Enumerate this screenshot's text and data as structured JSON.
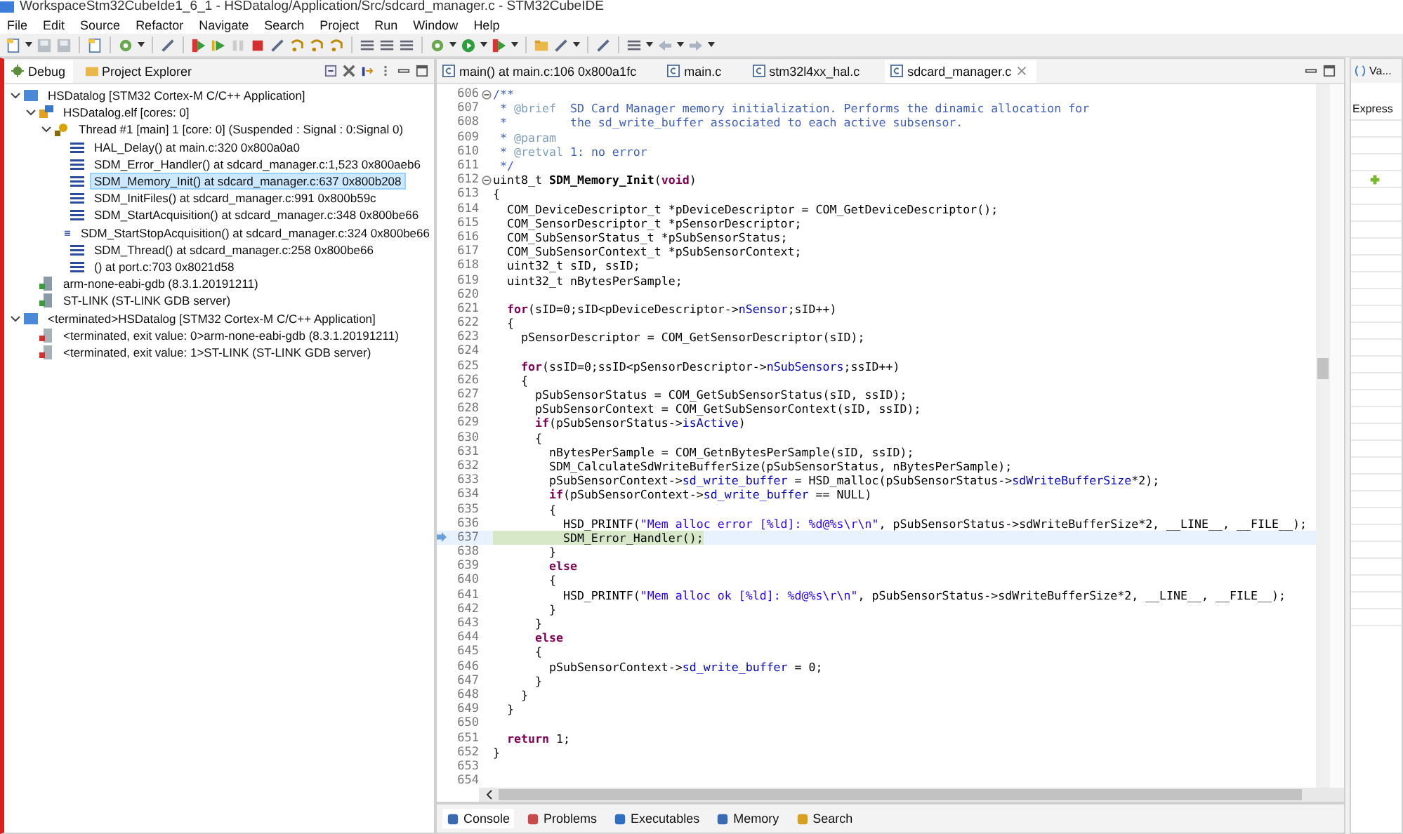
{
  "window": {
    "title": "WorkspaceStm32CubeIde1_6_1 - HSDatalog/Application/Src/sdcard_manager.c - STM32CubeIDE"
  },
  "menu": [
    "File",
    "Edit",
    "Source",
    "Refactor",
    "Navigate",
    "Search",
    "Project",
    "Run",
    "Window",
    "Help"
  ],
  "left_panel": {
    "tabs": [
      {
        "label": "Debug",
        "selected": true
      },
      {
        "label": "Project Explorer",
        "selected": false
      }
    ],
    "tree": [
      {
        "kind": "launch",
        "label": "HSDatalog [STM32 Cortex-M C/C++ Application]",
        "expanded": true,
        "selected": false,
        "children": [
          {
            "kind": "elf",
            "label": "HSDatalog.elf [cores: 0]",
            "expanded": true,
            "selected": false,
            "children": [
              {
                "kind": "thread",
                "label": "Thread #1 [main] 1 [core: 0] (Suspended : Signal : 0:Signal 0)",
                "expanded": true,
                "selected": false,
                "children": [
                  {
                    "kind": "frame",
                    "label": "HAL_Delay() at main.c:320 0x800a0a0",
                    "selected": false
                  },
                  {
                    "kind": "frame",
                    "label": "SDM_Error_Handler() at sdcard_manager.c:1,523 0x800aeb6",
                    "selected": false
                  },
                  {
                    "kind": "frame",
                    "label": "SDM_Memory_Init() at sdcard_manager.c:637 0x800b208",
                    "selected": true
                  },
                  {
                    "kind": "frame",
                    "label": "SDM_InitFiles() at sdcard_manager.c:991 0x800b59c",
                    "selected": false
                  },
                  {
                    "kind": "frame",
                    "label": "SDM_StartAcquisition() at sdcard_manager.c:348 0x800be66",
                    "selected": false
                  },
                  {
                    "kind": "frame",
                    "label": "SDM_StartStopAcquisition() at sdcard_manager.c:324 0x800be66",
                    "selected": false
                  },
                  {
                    "kind": "frame",
                    "label": "SDM_Thread() at sdcard_manager.c:258 0x800be66",
                    "selected": false
                  },
                  {
                    "kind": "frame",
                    "label": "() at port.c:703 0x8021d58",
                    "selected": false
                  }
                ]
              }
            ]
          },
          {
            "kind": "process",
            "label": "arm-none-eabi-gdb (8.3.1.20191211)",
            "selected": false
          },
          {
            "kind": "process",
            "label": "ST-LINK (ST-LINK GDB server)",
            "selected": false
          }
        ]
      },
      {
        "kind": "launch",
        "label": "<terminated>HSDatalog [STM32 Cortex-M C/C++ Application]",
        "expanded": true,
        "selected": false,
        "children": [
          {
            "kind": "terminated",
            "label": "<terminated, exit value: 0>arm-none-eabi-gdb (8.3.1.20191211)",
            "selected": false
          },
          {
            "kind": "terminated",
            "label": "<terminated, exit value: 1>ST-LINK (ST-LINK GDB server)",
            "selected": false
          }
        ]
      }
    ]
  },
  "editor": {
    "tabs": [
      {
        "label": "main() at main.c:106 0x800a1fc",
        "selected": false,
        "closable": false
      },
      {
        "label": "main.c",
        "selected": false,
        "closable": false
      },
      {
        "label": "stm32l4xx_hal.c",
        "selected": false,
        "closable": false
      },
      {
        "label": "sdcard_manager.c",
        "selected": true,
        "closable": true
      }
    ],
    "lines": [
      {
        "n": "606",
        "fold": true,
        "current": false,
        "s": [
          {
            "kind": "comment",
            "t": "/**"
          }
        ]
      },
      {
        "n": "607",
        "fold": false,
        "current": false,
        "s": [
          {
            "kind": "comment",
            "t": " * "
          },
          {
            "kind": "tag",
            "t": "@brief"
          },
          {
            "kind": "comment",
            "t": "  SD Card Manager memory initialization. Performs the dinamic allocation for"
          }
        ]
      },
      {
        "n": "608",
        "fold": false,
        "current": false,
        "s": [
          {
            "kind": "comment",
            "t": " *         the sd_write_buffer associated to each active subsensor."
          }
        ]
      },
      {
        "n": "609",
        "fold": false,
        "current": false,
        "s": [
          {
            "kind": "comment",
            "t": " * "
          },
          {
            "kind": "tag",
            "t": "@param"
          }
        ]
      },
      {
        "n": "610",
        "fold": false,
        "current": false,
        "s": [
          {
            "kind": "comment",
            "t": " * "
          },
          {
            "kind": "tag",
            "t": "@retval"
          },
          {
            "kind": "comment",
            "t": " 1: no error"
          }
        ]
      },
      {
        "n": "611",
        "fold": false,
        "current": false,
        "s": [
          {
            "kind": "comment",
            "t": " */"
          }
        ]
      },
      {
        "n": "612",
        "fold": true,
        "current": false,
        "s": [
          {
            "kind": "text",
            "t": "uint8_t "
          },
          {
            "kind": "fn",
            "t": "SDM_Memory_Init"
          },
          {
            "kind": "text",
            "t": "("
          },
          {
            "kind": "kw",
            "t": "void"
          },
          {
            "kind": "text",
            "t": ")"
          }
        ]
      },
      {
        "n": "613",
        "fold": false,
        "current": false,
        "s": [
          {
            "kind": "text",
            "t": "{"
          }
        ]
      },
      {
        "n": "614",
        "fold": false,
        "current": false,
        "s": [
          {
            "kind": "text",
            "t": "  COM_DeviceDescriptor_t *pDeviceDescriptor = COM_GetDeviceDescriptor();"
          }
        ]
      },
      {
        "n": "615",
        "fold": false,
        "current": false,
        "s": [
          {
            "kind": "text",
            "t": "  COM_SensorDescriptor_t *pSensorDescriptor;"
          }
        ]
      },
      {
        "n": "616",
        "fold": false,
        "current": false,
        "s": [
          {
            "kind": "text",
            "t": "  COM_SubSensorStatus_t *pSubSensorStatus;"
          }
        ]
      },
      {
        "n": "617",
        "fold": false,
        "current": false,
        "s": [
          {
            "kind": "text",
            "t": "  COM_SubSensorContext_t *pSubSensorContext;"
          }
        ]
      },
      {
        "n": "618",
        "fold": false,
        "current": false,
        "s": [
          {
            "kind": "text",
            "t": "  uint32_t sID, ssID;"
          }
        ]
      },
      {
        "n": "619",
        "fold": false,
        "current": false,
        "s": [
          {
            "kind": "text",
            "t": "  uint32_t nBytesPerSample;"
          }
        ]
      },
      {
        "n": "620",
        "fold": false,
        "current": false
      },
      {
        "n": "621",
        "fold": false,
        "current": false,
        "s": [
          {
            "kind": "kw",
            "t": "  for"
          },
          {
            "kind": "text",
            "t": "(sID=0;sID<pDeviceDescriptor->"
          },
          {
            "kind": "field",
            "t": "nSensor"
          },
          {
            "kind": "text",
            "t": ";sID++)"
          }
        ]
      },
      {
        "n": "622",
        "fold": false,
        "current": false,
        "s": [
          {
            "kind": "text",
            "t": "  {"
          }
        ]
      },
      {
        "n": "623",
        "fold": false,
        "current": false,
        "s": [
          {
            "kind": "text",
            "t": "    pSensorDescriptor = COM_GetSensorDescriptor(sID);"
          }
        ]
      },
      {
        "n": "624",
        "fold": false,
        "current": false
      },
      {
        "n": "625",
        "fold": false,
        "current": false,
        "s": [
          {
            "kind": "kw",
            "t": "    for"
          },
          {
            "kind": "text",
            "t": "(ssID=0;ssID<pSensorDescriptor->"
          },
          {
            "kind": "field",
            "t": "nSubSensors"
          },
          {
            "kind": "text",
            "t": ";ssID++)"
          }
        ]
      },
      {
        "n": "626",
        "fold": false,
        "current": false,
        "s": [
          {
            "kind": "text",
            "t": "    {"
          }
        ]
      },
      {
        "n": "627",
        "fold": false,
        "current": false,
        "s": [
          {
            "kind": "text",
            "t": "      pSubSensorStatus = COM_GetSubSensorStatus(sID, ssID);"
          }
        ]
      },
      {
        "n": "628",
        "fold": false,
        "current": false,
        "s": [
          {
            "kind": "text",
            "t": "      pSubSensorContext = COM_GetSubSensorContext(sID, ssID);"
          }
        ]
      },
      {
        "n": "629",
        "fold": false,
        "current": false,
        "s": [
          {
            "kind": "kw",
            "t": "      if"
          },
          {
            "kind": "text",
            "t": "(pSubSensorStatus->"
          },
          {
            "kind": "field",
            "t": "isActive"
          },
          {
            "kind": "text",
            "t": ")"
          }
        ]
      },
      {
        "n": "630",
        "fold": false,
        "current": false,
        "s": [
          {
            "kind": "text",
            "t": "      {"
          }
        ]
      },
      {
        "n": "631",
        "fold": false,
        "current": false,
        "s": [
          {
            "kind": "text",
            "t": "        nBytesPerSample = COM_GetnBytesPerSample(sID, ssID);"
          }
        ]
      },
      {
        "n": "632",
        "fold": false,
        "current": false,
        "s": [
          {
            "kind": "text",
            "t": "        SDM_CalculateSdWriteBufferSize(pSubSensorStatus, nBytesPerSample);"
          }
        ]
      },
      {
        "n": "633",
        "fold": false,
        "current": false,
        "s": [
          {
            "kind": "text",
            "t": "        pSubSensorContext->"
          },
          {
            "kind": "field",
            "t": "sd_write_buffer"
          },
          {
            "kind": "text",
            "t": " = HSD_malloc(pSubSensorStatus->"
          },
          {
            "kind": "field",
            "t": "sdWriteBufferSize"
          },
          {
            "kind": "text",
            "t": "*2);"
          }
        ]
      },
      {
        "n": "634",
        "fold": false,
        "current": false,
        "s": [
          {
            "kind": "kw",
            "t": "        if"
          },
          {
            "kind": "text",
            "t": "(pSubSensorContext->"
          },
          {
            "kind": "field",
            "t": "sd_write_buffer"
          },
          {
            "kind": "text",
            "t": " == NULL)"
          }
        ]
      },
      {
        "n": "635",
        "fold": false,
        "current": false,
        "s": [
          {
            "kind": "text",
            "t": "        {"
          }
        ]
      },
      {
        "n": "636",
        "fold": false,
        "current": false,
        "s": [
          {
            "kind": "text",
            "t": "          HSD_PRINTF("
          },
          {
            "kind": "str",
            "t": "\"Mem alloc error [%ld]: %d@%s\\r\\n\""
          },
          {
            "kind": "text",
            "t": ", pSubSensorStatus->sdWriteBufferSize*2, __LINE__, __FILE__);"
          }
        ]
      },
      {
        "n": "637",
        "fold": false,
        "current": true,
        "s": [
          {
            "kind": "text",
            "t": "          SDM_Error_Handler();"
          }
        ]
      },
      {
        "n": "638",
        "fold": false,
        "current": false,
        "s": [
          {
            "kind": "text",
            "t": "        }"
          }
        ]
      },
      {
        "n": "639",
        "fold": false,
        "current": false,
        "s": [
          {
            "kind": "kw",
            "t": "        else"
          }
        ]
      },
      {
        "n": "640",
        "fold": false,
        "current": false,
        "s": [
          {
            "kind": "text",
            "t": "        {"
          }
        ]
      },
      {
        "n": "641",
        "fold": false,
        "current": false,
        "s": [
          {
            "kind": "text",
            "t": "          HSD_PRINTF("
          },
          {
            "kind": "str",
            "t": "\"Mem alloc ok [%ld]: %d@%s\\r\\n\""
          },
          {
            "kind": "text",
            "t": ", pSubSensorStatus->sdWriteBufferSize*2, __LINE__, __FILE__);"
          }
        ]
      },
      {
        "n": "642",
        "fold": false,
        "current": false,
        "s": [
          {
            "kind": "text",
            "t": "        }"
          }
        ]
      },
      {
        "n": "643",
        "fold": false,
        "current": false,
        "s": [
          {
            "kind": "text",
            "t": "      }"
          }
        ]
      },
      {
        "n": "644",
        "fold": false,
        "current": false,
        "s": [
          {
            "kind": "kw",
            "t": "      else"
          }
        ]
      },
      {
        "n": "645",
        "fold": false,
        "current": false,
        "s": [
          {
            "kind": "text",
            "t": "      {"
          }
        ]
      },
      {
        "n": "646",
        "fold": false,
        "current": false,
        "s": [
          {
            "kind": "text",
            "t": "        pSubSensorContext->"
          },
          {
            "kind": "field",
            "t": "sd_write_buffer"
          },
          {
            "kind": "text",
            "t": " = 0;"
          }
        ]
      },
      {
        "n": "647",
        "fold": false,
        "current": false,
        "s": [
          {
            "kind": "text",
            "t": "      }"
          }
        ]
      },
      {
        "n": "648",
        "fold": false,
        "current": false,
        "s": [
          {
            "kind": "text",
            "t": "    }"
          }
        ]
      },
      {
        "n": "649",
        "fold": false,
        "current": false,
        "s": [
          {
            "kind": "text",
            "t": "  }"
          }
        ]
      },
      {
        "n": "650",
        "fold": false,
        "current": false
      },
      {
        "n": "651",
        "fold": false,
        "current": false,
        "s": [
          {
            "kind": "kw",
            "t": "  return"
          },
          {
            "kind": "text",
            "t": " 1;"
          }
        ]
      },
      {
        "n": "652",
        "fold": false,
        "current": false,
        "s": [
          {
            "kind": "text",
            "t": "}"
          }
        ]
      },
      {
        "n": "653",
        "fold": false,
        "current": false
      },
      {
        "n": "654",
        "fold": false,
        "current": false
      }
    ]
  },
  "right_panel": {
    "tab": "Va...",
    "header": "Express"
  },
  "bottom_tabs": [
    {
      "label": "Console",
      "selected": true
    },
    {
      "label": "Problems",
      "selected": false
    },
    {
      "label": "Executables",
      "selected": false
    },
    {
      "label": "Memory",
      "selected": false
    },
    {
      "label": "Search",
      "selected": false
    }
  ]
}
